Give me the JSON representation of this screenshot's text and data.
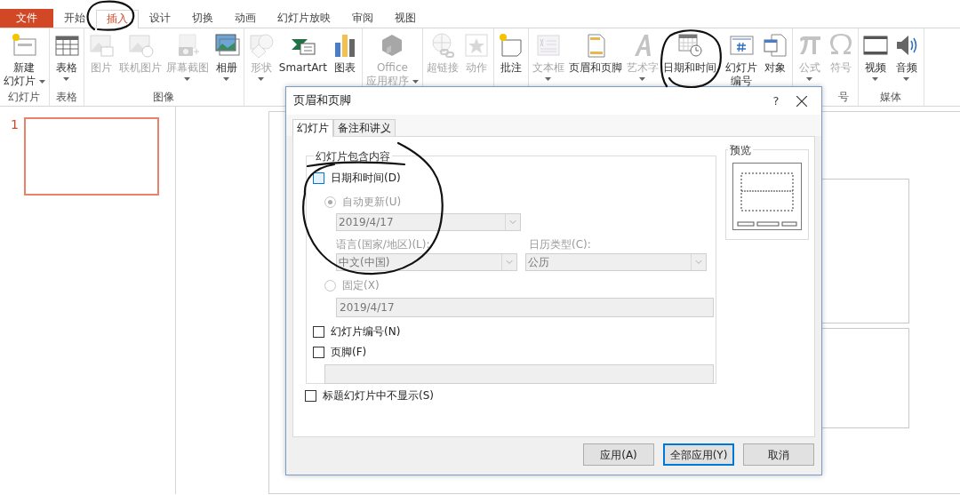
{
  "ribbon_tabs": [
    {
      "label": "文件",
      "kind": "file",
      "selected": false
    },
    {
      "label": "开始",
      "kind": "tab",
      "selected": false
    },
    {
      "label": "插入",
      "kind": "tab",
      "selected": true
    },
    {
      "label": "设计",
      "kind": "tab",
      "selected": false
    },
    {
      "label": "切换",
      "kind": "tab",
      "selected": false
    },
    {
      "label": "动画",
      "kind": "tab",
      "selected": false
    },
    {
      "label": "幻灯片放映",
      "kind": "tab",
      "selected": false
    },
    {
      "label": "审阅",
      "kind": "tab",
      "selected": false
    },
    {
      "label": "视图",
      "kind": "tab",
      "selected": false
    }
  ],
  "ribbon_groups": [
    {
      "label": "幻灯片",
      "buttons": [
        {
          "lines": [
            "新建",
            "幻灯片"
          ],
          "disabled": false,
          "dropdown": true
        }
      ]
    },
    {
      "label": "表格",
      "buttons": [
        {
          "lines": [
            "表格"
          ],
          "disabled": false,
          "dropdown": true
        }
      ]
    },
    {
      "label": "图像",
      "buttons": [
        {
          "lines": [
            "图片"
          ],
          "disabled": true,
          "dropdown": false
        },
        {
          "lines": [
            "联机图片"
          ],
          "disabled": true,
          "dropdown": false
        },
        {
          "lines": [
            "屏幕截图"
          ],
          "disabled": true,
          "dropdown": true
        },
        {
          "lines": [
            "相册"
          ],
          "disabled": false,
          "dropdown": true
        }
      ]
    },
    {
      "buttons": [
        {
          "lines": [
            "形状"
          ],
          "disabled": true,
          "dropdown": true
        },
        {
          "lines": [
            "SmartArt"
          ],
          "disabled": false,
          "dropdown": false
        },
        {
          "lines": [
            "图表"
          ],
          "disabled": false,
          "dropdown": false
        }
      ]
    },
    {
      "buttons": [
        {
          "lines": [
            "Office",
            "应用程序"
          ],
          "disabled": true,
          "dropdown": true
        }
      ]
    },
    {
      "buttons": [
        {
          "lines": [
            "超链接"
          ],
          "disabled": true,
          "dropdown": false
        },
        {
          "lines": [
            "动作"
          ],
          "disabled": true,
          "dropdown": false
        }
      ]
    },
    {
      "buttons": [
        {
          "lines": [
            "批注"
          ],
          "disabled": false,
          "dropdown": false
        }
      ]
    },
    {
      "buttons": [
        {
          "lines": [
            "文本框"
          ],
          "disabled": true,
          "dropdown": true
        },
        {
          "lines": [
            "页眉和页脚"
          ],
          "disabled": false,
          "dropdown": false
        },
        {
          "lines": [
            "艺术字"
          ],
          "disabled": true,
          "dropdown": true
        },
        {
          "lines": [
            "日期和时间"
          ],
          "disabled": false,
          "dropdown": false
        },
        {
          "lines": [
            "幻灯片",
            "编号"
          ],
          "disabled": false,
          "dropdown": false
        },
        {
          "lines": [
            "对象"
          ],
          "disabled": false,
          "dropdown": false
        }
      ]
    },
    {
      "label": "号",
      "buttons": [
        {
          "lines": [
            "公式"
          ],
          "disabled": true,
          "dropdown": true
        },
        {
          "lines": [
            "符号"
          ],
          "disabled": true,
          "dropdown": false
        }
      ]
    },
    {
      "label": "媒体",
      "buttons": [
        {
          "lines": [
            "视频"
          ],
          "disabled": false,
          "dropdown": true
        },
        {
          "lines": [
            "音频"
          ],
          "disabled": false,
          "dropdown": true
        }
      ]
    }
  ],
  "thumbnails": [
    {
      "number": "1",
      "selected": true
    }
  ],
  "dialog": {
    "title": "页眉和页脚",
    "help": "?",
    "tabs": [
      {
        "label": "幻灯片",
        "selected": true
      },
      {
        "label": "备注和讲义",
        "selected": false
      }
    ],
    "slide_group": {
      "legend": "幻灯片包含内容",
      "date_time": {
        "label": "日期和时间(D)",
        "checked": false,
        "highlighted": true
      },
      "auto_update": {
        "label": "自动更新(U)",
        "selected": true,
        "disabled": true
      },
      "auto_date": {
        "value": "2019/4/17",
        "disabled": true
      },
      "language_label": "语言(国家/地区)(L):",
      "language": {
        "value": "中文(中国)",
        "disabled": true
      },
      "calendar_label": "日历类型(C):",
      "calendar": {
        "value": "公历",
        "disabled": true
      },
      "fixed": {
        "label": "固定(X)",
        "selected": false,
        "disabled": true
      },
      "fixed_date": {
        "value": "2019/4/17",
        "disabled": true
      },
      "slide_number": {
        "label": "幻灯片编号(N)",
        "checked": false,
        "highlighted": false
      },
      "footer": {
        "label": "页脚(F)",
        "checked": false,
        "highlighted": false
      },
      "footer_text": {
        "disabled": true
      }
    },
    "hide_on_title": {
      "label": "标题幻灯片中不显示(S)",
      "checked": false,
      "highlighted": false
    },
    "preview": {
      "legend": "预览"
    },
    "buttons": [
      {
        "label": "应用(A)",
        "default": false
      },
      {
        "label": "全部应用(Y)",
        "default": true
      },
      {
        "label": "取消",
        "default": false
      }
    ]
  },
  "ink_marks": [
    {
      "kind": "tab-circle"
    },
    {
      "kind": "button-circle"
    },
    {
      "kind": "lasso"
    }
  ]
}
